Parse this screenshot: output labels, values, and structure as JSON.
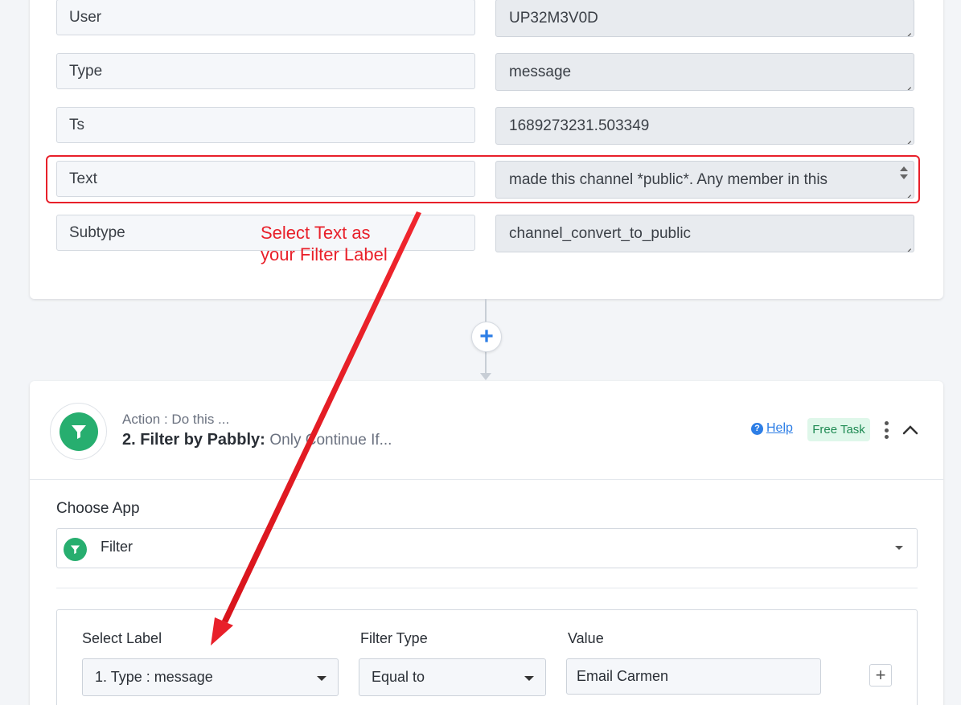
{
  "fields": [
    {
      "label": "User",
      "value": "UP32M3V0D"
    },
    {
      "label": "Type",
      "value": "message"
    },
    {
      "label": "Ts",
      "value": "1689273231.503349"
    },
    {
      "label": "Text",
      "value": "made this channel *public*. Any member in this"
    },
    {
      "label": "Subtype",
      "value": "channel_convert_to_public"
    }
  ],
  "annotation": {
    "line1": "Select Text as",
    "line2": "your Filter Label",
    "color": "#e8202a"
  },
  "action": {
    "subtitle": "Action : Do this ...",
    "title": "2. Filter by Pabbly:",
    "title_suffix": "Only Continue If...",
    "help": "Help",
    "badge": "Free Task"
  },
  "choose_app": {
    "label": "Choose App",
    "value": "Filter"
  },
  "filter": {
    "select_label": "Select Label",
    "select_value": "1. Type : message",
    "filter_type_label": "Filter Type",
    "filter_type_value": "Equal to",
    "value_label": "Value",
    "value": "Email Carmen"
  },
  "colors": {
    "accent": "#2d7ee6",
    "filter_green": "#27ae6f",
    "annotation_red": "#e8202a"
  }
}
